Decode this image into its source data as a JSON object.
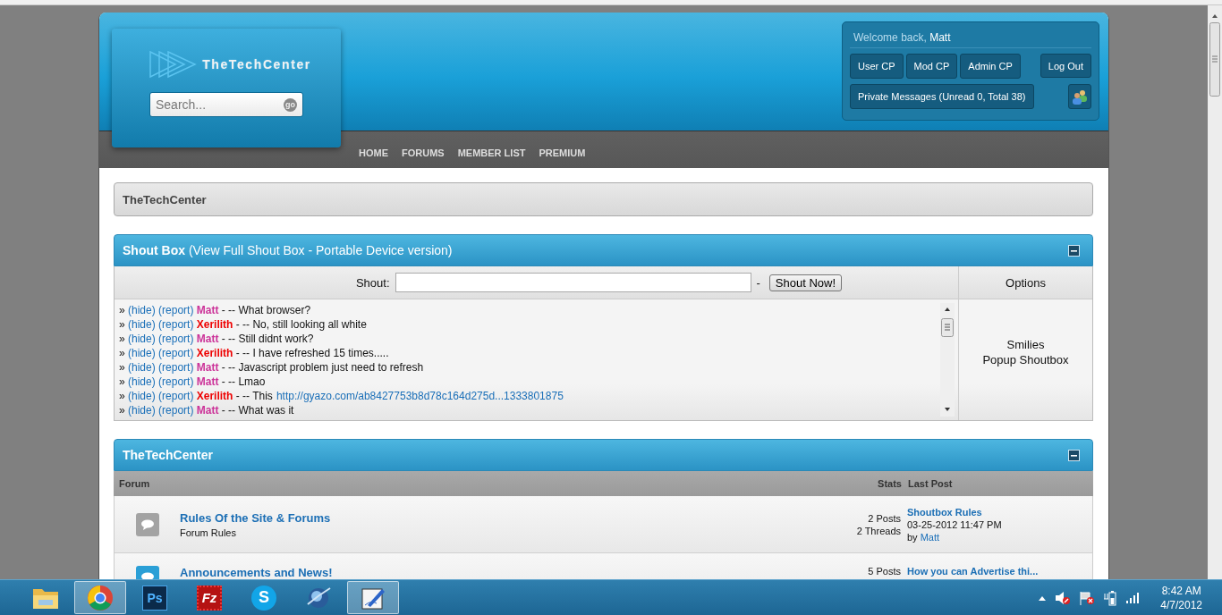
{
  "header": {
    "logo": "TheTechCenter",
    "search": {
      "placeholder": "Search...",
      "button": "go"
    }
  },
  "user_panel": {
    "greeting": "Welcome back,",
    "user": "Matt",
    "buttons": [
      "User CP",
      "Mod CP",
      "Admin CP"
    ],
    "logout": "Log Out",
    "messages": "Private Messages (Unread 0, Total 38)"
  },
  "nav": [
    "HOME",
    "FORUMS",
    "MEMBER LIST",
    "PREMIUM"
  ],
  "breadcrumb": "TheTechCenter",
  "shoutbox": {
    "title": "Shout Box",
    "subtitle": "(View Full Shout Box - Portable Device version)",
    "label": "Shout:",
    "separator": "-",
    "button": "Shout Now!",
    "options_title": "Options",
    "options": [
      "Smilies",
      "Popup Shoutbox"
    ],
    "messages": [
      {
        "bullet": "»",
        "hide": "(hide)",
        "report": "(report)",
        "user": "Matt",
        "color": "#cc3399",
        "text": "- -- What browser?"
      },
      {
        "bullet": "»",
        "hide": "(hide)",
        "report": "(report)",
        "user": "Xerilith",
        "color": "#ee0000",
        "text": "- -- No, still looking all white"
      },
      {
        "bullet": "»",
        "hide": "(hide)",
        "report": "(report)",
        "user": "Matt",
        "color": "#cc3399",
        "text": "- -- Still didnt work?"
      },
      {
        "bullet": "»",
        "hide": "(hide)",
        "report": "(report)",
        "user": "Xerilith",
        "color": "#ee0000",
        "text": "- -- I have refreshed 15 times....."
      },
      {
        "bullet": "»",
        "hide": "(hide)",
        "report": "(report)",
        "user": "Matt",
        "color": "#cc3399",
        "text": "- -- Javascript problem just need to refresh"
      },
      {
        "bullet": "»",
        "hide": "(hide)",
        "report": "(report)",
        "user": "Matt",
        "color": "#cc3399",
        "text": "- -- Lmao"
      },
      {
        "bullet": "»",
        "hide": "(hide)",
        "report": "(report)",
        "user": "Xerilith",
        "color": "#ee0000",
        "text": "- -- This",
        "link": "http://gyazo.com/ab8427753b8d78c164d275d...1333801875"
      },
      {
        "bullet": "»",
        "hide": "(hide)",
        "report": "(report)",
        "user": "Matt",
        "color": "#cc3399",
        "text": "- -- What was it"
      }
    ]
  },
  "forum_section": {
    "title": "TheTechCenter",
    "columns": [
      "Forum",
      "Stats",
      "Last Post"
    ],
    "rows": [
      {
        "title": "Rules Of the Site & Forums",
        "description": "Forum Rules",
        "unread": false,
        "stats": [
          "2 Posts",
          "2 Threads"
        ],
        "last_post": {
          "title": "Shoutbox Rules",
          "date": "03-25-2012 11:47 PM",
          "by": "by",
          "user": "Matt"
        }
      },
      {
        "title": "Announcements and News!",
        "unread": true,
        "stats": [
          "5 Posts"
        ],
        "last_post": {
          "title": "How you can Advertise thi..."
        }
      }
    ]
  },
  "taskbar": {
    "apps": [
      {
        "kind": "folder",
        "selected": false
      },
      {
        "kind": "chrome",
        "selected": true
      },
      {
        "kind": "photoshop",
        "label": "Ps",
        "selected": false
      },
      {
        "kind": "filezilla",
        "label": "Fz",
        "selected": false
      },
      {
        "kind": "skype",
        "label": "S",
        "selected": false
      },
      {
        "kind": "orb",
        "selected": false
      },
      {
        "kind": "pen",
        "selected": true
      }
    ],
    "time": "8:42 AM",
    "date": "4/7/2012"
  }
}
